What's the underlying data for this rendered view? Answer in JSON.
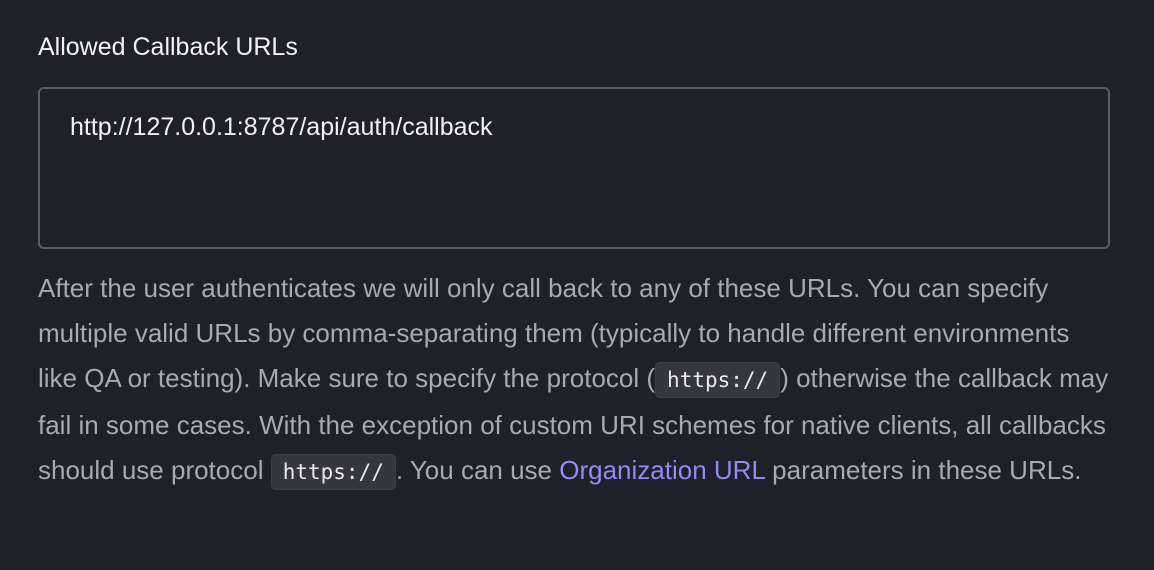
{
  "field": {
    "label": "Allowed Callback URLs",
    "value": "http://127.0.0.1:8787/api/auth/callback"
  },
  "help": {
    "seg1": "After the user authenticates we will only call back to any of these URLs. You can specify multiple valid URLs by comma-separating them (typically to handle different environments like QA or testing). Make sure to specify the protocol (",
    "code1": "https://",
    "seg2": ") otherwise the callback may fail in some cases. With the exception of custom URI schemes for native clients, all callbacks should use protocol ",
    "code2": "https://",
    "seg3": ". You can use ",
    "link": "Organization URL",
    "seg4": " parameters in these URLs."
  },
  "colors": {
    "background": "#1f2029",
    "link": "#8f8cf4",
    "border": "#5b5d67"
  }
}
